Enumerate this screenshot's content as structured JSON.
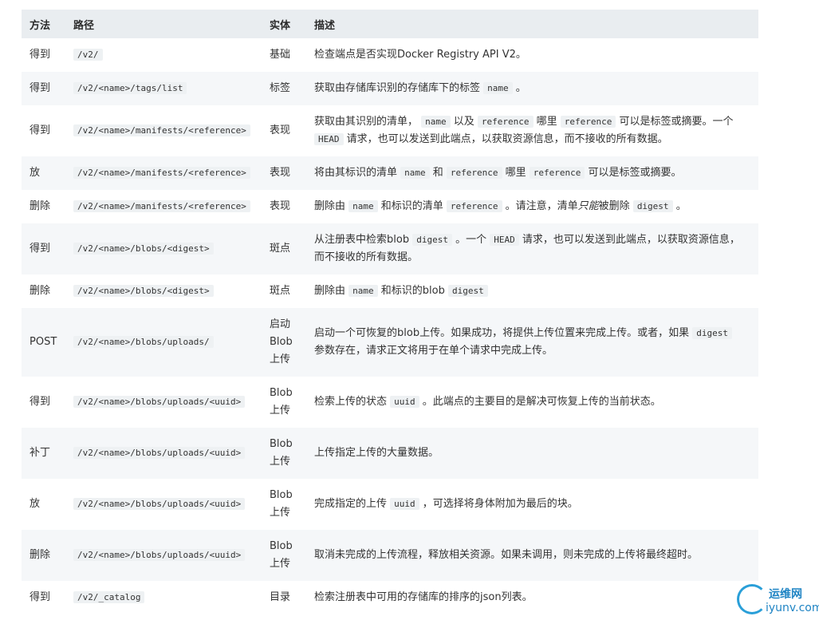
{
  "headers": {
    "method": "方法",
    "path": "路径",
    "entity": "实体",
    "desc": "描述"
  },
  "rows": [
    {
      "method": "得到",
      "path": "/v2/",
      "entity": [
        "基础"
      ],
      "d": [
        {
          "t": "检查端点是否实现Docker Registry API V2。"
        }
      ]
    },
    {
      "method": "得到",
      "path": "/v2/<name>/tags/list",
      "entity": [
        "标签"
      ],
      "d": [
        {
          "t": "获取由存储库识别的存储库下的标签 "
        },
        {
          "c": "name"
        },
        {
          "t": " 。"
        }
      ]
    },
    {
      "method": "得到",
      "path": "/v2/<name>/manifests/<reference>",
      "entity": [
        "表现"
      ],
      "d": [
        {
          "t": "获取由其识别的清单， "
        },
        {
          "c": "name"
        },
        {
          "t": " 以及 "
        },
        {
          "c": "reference"
        },
        {
          "t": " 哪里 "
        },
        {
          "c": "reference"
        },
        {
          "t": " 可以是标签或摘要。一个 "
        },
        {
          "c": "HEAD"
        },
        {
          "t": " 请求，也可以发送到此端点，以获取资源信息，而不接收的所有数据。"
        }
      ]
    },
    {
      "method": "放",
      "path": "/v2/<name>/manifests/<reference>",
      "entity": [
        "表现"
      ],
      "d": [
        {
          "t": "将由其标识的清单 "
        },
        {
          "c": "name"
        },
        {
          "t": " 和 "
        },
        {
          "c": "reference"
        },
        {
          "t": " 哪里 "
        },
        {
          "c": "reference"
        },
        {
          "t": " 可以是标签或摘要。"
        }
      ]
    },
    {
      "method": "删除",
      "path": "/v2/<name>/manifests/<reference>",
      "entity": [
        "表现"
      ],
      "d": [
        {
          "t": "删除由 "
        },
        {
          "c": "name"
        },
        {
          "t": " 和标识的清单 "
        },
        {
          "c": "reference"
        },
        {
          "t": " 。请注意，清单"
        },
        {
          "i": "只能"
        },
        {
          "t": "被删除 "
        },
        {
          "c": "digest"
        },
        {
          "t": " 。"
        }
      ]
    },
    {
      "method": "得到",
      "path": "/v2/<name>/blobs/<digest>",
      "entity": [
        "斑点"
      ],
      "d": [
        {
          "t": "从注册表中检索blob "
        },
        {
          "c": "digest"
        },
        {
          "t": " 。一个 "
        },
        {
          "c": "HEAD"
        },
        {
          "t": " 请求，也可以发送到此端点，以获取资源信息，而不接收的所有数据。"
        }
      ]
    },
    {
      "method": "删除",
      "path": "/v2/<name>/blobs/<digest>",
      "entity": [
        "斑点"
      ],
      "d": [
        {
          "t": "删除由 "
        },
        {
          "c": "name"
        },
        {
          "t": " 和标识的blob "
        },
        {
          "c": "digest"
        }
      ]
    },
    {
      "method": "POST",
      "path": "/v2/<name>/blobs/uploads/",
      "entity": [
        "启动",
        "Blob",
        "上传"
      ],
      "d": [
        {
          "t": "启动一个可恢复的blob上传。如果成功，将提供上传位置来完成上传。或者，如果 "
        },
        {
          "c": "digest"
        },
        {
          "t": " 参数存在，请求正文将用于在单个请求中完成上传。"
        }
      ]
    },
    {
      "method": "得到",
      "path": "/v2/<name>/blobs/uploads/<uuid>",
      "entity": [
        "Blob",
        "上传"
      ],
      "d": [
        {
          "t": "检索上传的状态 "
        },
        {
          "c": "uuid"
        },
        {
          "t": " 。此端点的主要目的是解决可恢复上传的当前状态。"
        }
      ]
    },
    {
      "method": "补丁",
      "path": "/v2/<name>/blobs/uploads/<uuid>",
      "entity": [
        "Blob",
        "上传"
      ],
      "d": [
        {
          "t": "上传指定上传的大量数据。"
        }
      ]
    },
    {
      "method": "放",
      "path": "/v2/<name>/blobs/uploads/<uuid>",
      "entity": [
        "Blob",
        "上传"
      ],
      "d": [
        {
          "t": "完成指定的上传 "
        },
        {
          "c": "uuid"
        },
        {
          "t": " ，可选择将身体附加为最后的块。"
        }
      ]
    },
    {
      "method": "删除",
      "path": "/v2/<name>/blobs/uploads/<uuid>",
      "entity": [
        "Blob",
        "上传"
      ],
      "d": [
        {
          "t": "取消未完成的上传流程，释放相关资源。如果未调用，则未完成的上传将最终超时。"
        }
      ]
    },
    {
      "method": "得到",
      "path": "/v2/_catalog",
      "entity": [
        "目录"
      ],
      "d": [
        {
          "t": "检索注册表中可用的存储库的排序的json列表。"
        }
      ]
    }
  ],
  "watermark": {
    "line1": "运维网",
    "line2": "iyunv.com"
  }
}
